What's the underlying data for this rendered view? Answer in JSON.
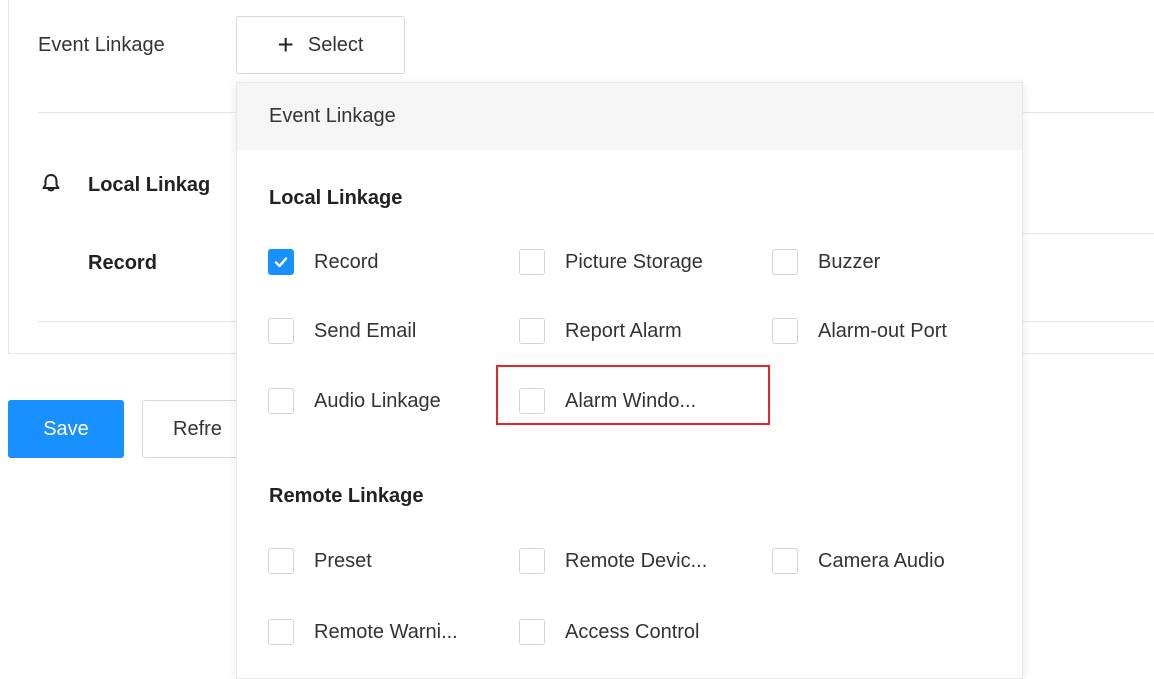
{
  "form": {
    "event_linkage_label": "Event Linkage",
    "select_button_label": "Select",
    "local_linkage_title": "Local Linkag",
    "record_label": "Record",
    "save_label": "Save",
    "refresh_label": "Refre"
  },
  "dropdown": {
    "header": "Event Linkage",
    "local_section": "Local Linkage",
    "remote_section": "Remote Linkage",
    "local_options": [
      {
        "label": "Record",
        "checked": true
      },
      {
        "label": "Picture Storage",
        "checked": false
      },
      {
        "label": "Buzzer",
        "checked": false
      },
      {
        "label": "Send Email",
        "checked": false
      },
      {
        "label": "Report Alarm",
        "checked": false
      },
      {
        "label": "Alarm-out Port",
        "checked": false
      },
      {
        "label": "Audio Linkage",
        "checked": false
      },
      {
        "label": "Alarm Windo...",
        "checked": false
      }
    ],
    "remote_options": [
      {
        "label": "Preset",
        "checked": false
      },
      {
        "label": "Remote Devic...",
        "checked": false
      },
      {
        "label": "Camera Audio",
        "checked": false
      },
      {
        "label": "Remote Warni...",
        "checked": false
      },
      {
        "label": "Access Control",
        "checked": false
      }
    ]
  },
  "colors": {
    "accent": "#1890ff",
    "highlight": "#e5252a"
  },
  "icons": {
    "select_button": "plus-icon",
    "local_linkage": "bell-icon",
    "checkbox": "check-icon"
  }
}
